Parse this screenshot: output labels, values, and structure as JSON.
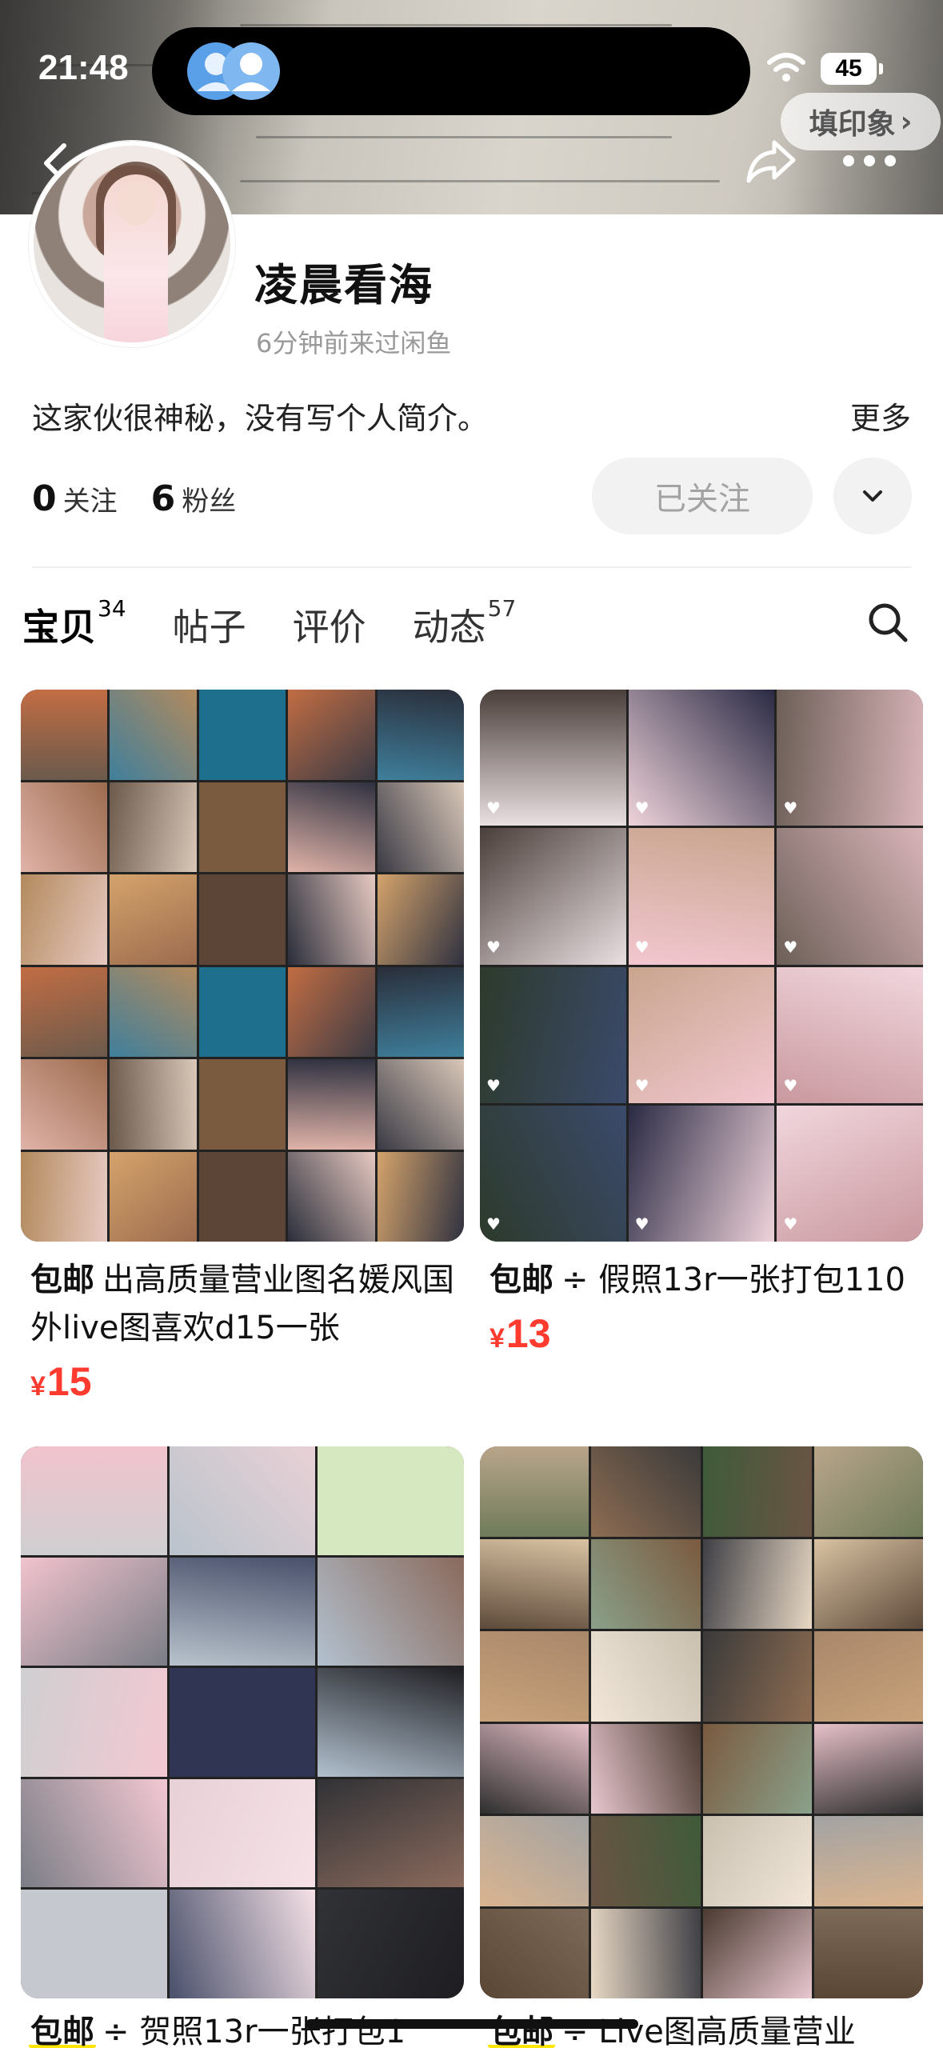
{
  "status_bar": {
    "time": "21:48",
    "battery": "45"
  },
  "top_nav": {
    "impression_button": "填印象",
    "impression_chevron": "›"
  },
  "profile": {
    "username": "凌晨看海",
    "last_seen": "6分钟前来过闲鱼",
    "bio": "这家伙很神秘，没有写个人简介。",
    "bio_more": "更多",
    "following_count": "0",
    "following_label": "关注",
    "followers_count": "6",
    "followers_label": "粉丝",
    "follow_button": "已关注"
  },
  "tabs": [
    {
      "label": "宝贝",
      "count": "34",
      "active": true
    },
    {
      "label": "帖子",
      "count": "",
      "active": false
    },
    {
      "label": "评价",
      "count": "",
      "active": false
    },
    {
      "label": "动态",
      "count": "57",
      "active": false
    }
  ],
  "products": [
    {
      "tag": "包邮",
      "title": "出高质量营业图名媛风国外live图喜欢d15一张",
      "currency": "¥",
      "price": "15"
    },
    {
      "tag": "包邮",
      "title": "÷ 假照13r一张打包110",
      "currency": "¥",
      "price": "13"
    },
    {
      "tag": "包邮",
      "title": "÷ 贺照13r一张打包1",
      "currency": "",
      "price": ""
    },
    {
      "tag": "包邮",
      "title": "÷ Live图高质量营业",
      "currency": "",
      "price": ""
    }
  ],
  "colors": {
    "accent_yellow": "#ffe500",
    "price_red": "#ff3b30",
    "follow_bg": "#f2f2f2",
    "muted_text": "#999999"
  },
  "icons": [
    "back-icon",
    "share-icon",
    "more-icon",
    "chevron-down-icon",
    "search-icon",
    "heart-icon",
    "wifi-icon",
    "app-icon"
  ]
}
